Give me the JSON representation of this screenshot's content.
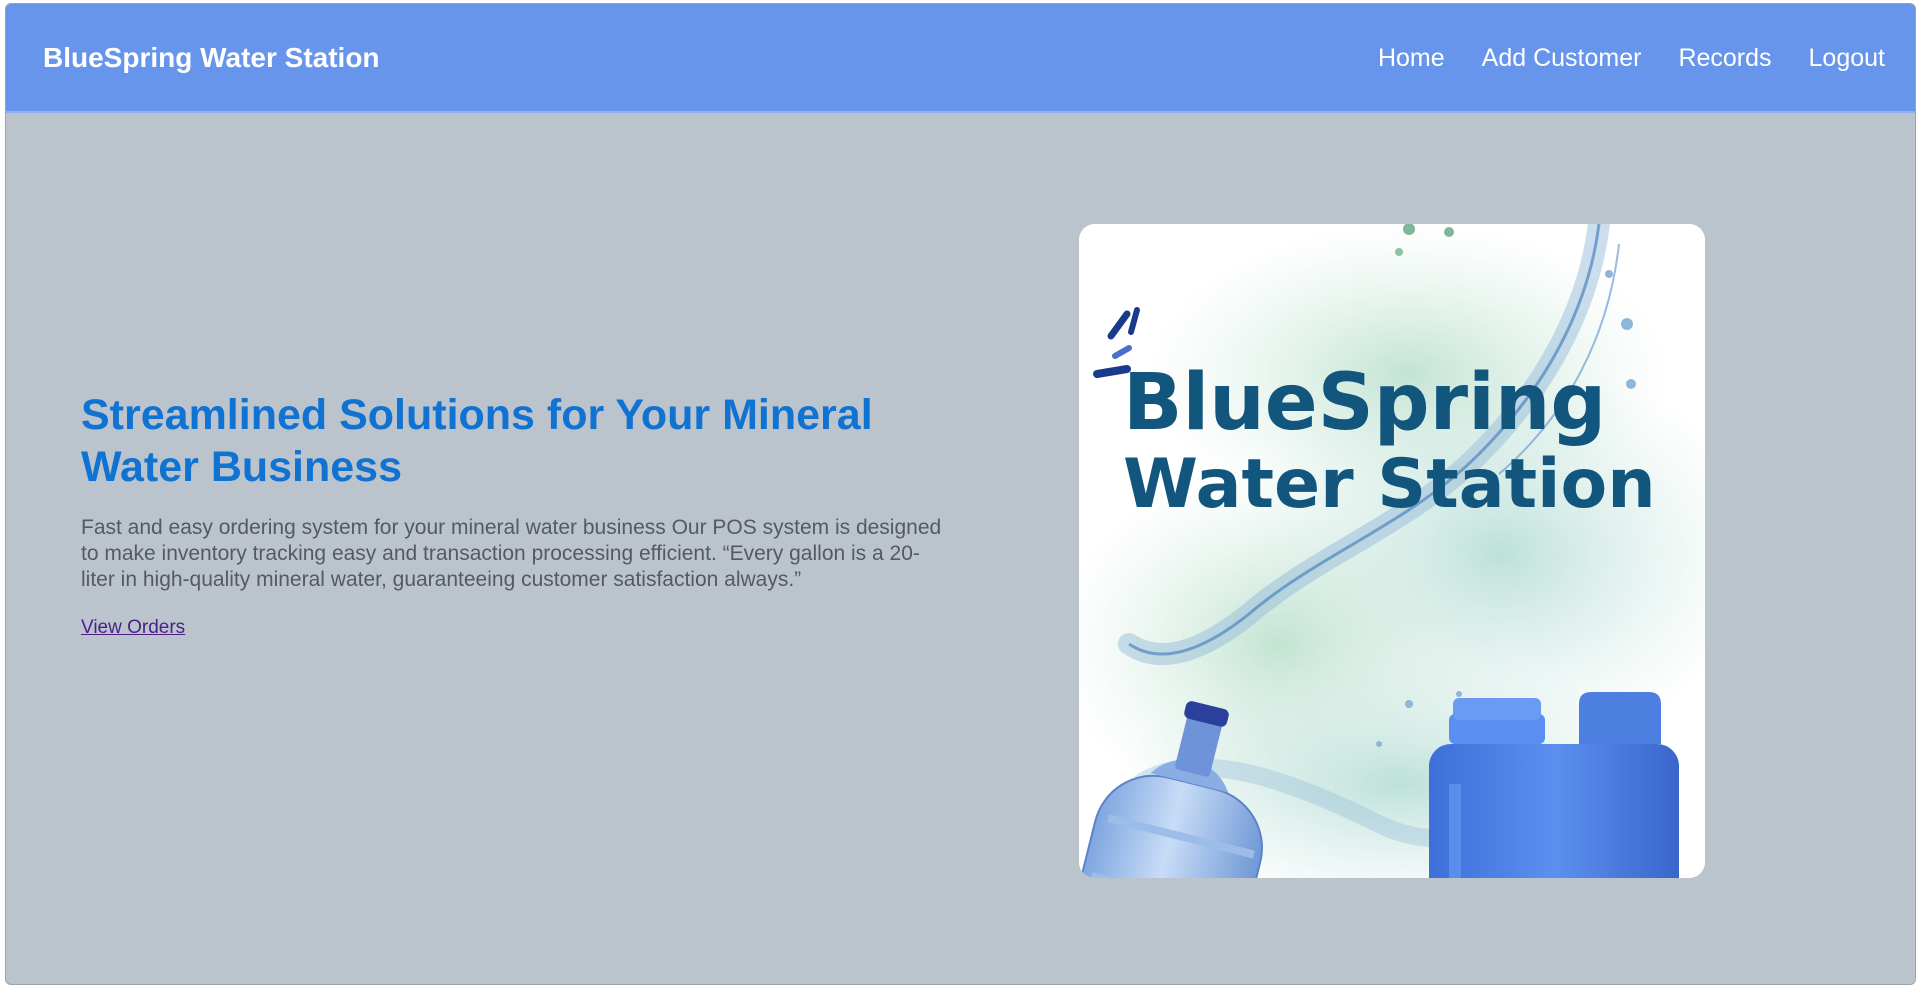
{
  "app": {
    "brand": "BlueSpring Water Station"
  },
  "nav": {
    "items": [
      {
        "label": "Home"
      },
      {
        "label": "Add Customer"
      },
      {
        "label": "Records"
      },
      {
        "label": "Logout"
      }
    ]
  },
  "hero": {
    "title": "Streamlined Solutions for Your Mineral Water Business",
    "description": "Fast and easy ordering system for your mineral  water business Our  POS system is designed to make inventory tracking easy and transaction processing efficient. “Every gallon is  a 20-liter in high-quality mineral water, guaranteeing customer satisfaction always.”",
    "link_label": "View Orders",
    "image": {
      "logo_line1": "BlueSpring",
      "logo_line2": "Water Station",
      "logo_color": "#12567e",
      "accent_color": "#1a3b8a"
    }
  },
  "colors": {
    "navbar": "#6795ec",
    "background": "#bbc4cc",
    "title": "#1073d2",
    "body_text": "#555a60",
    "link": "#4b1f8a"
  }
}
